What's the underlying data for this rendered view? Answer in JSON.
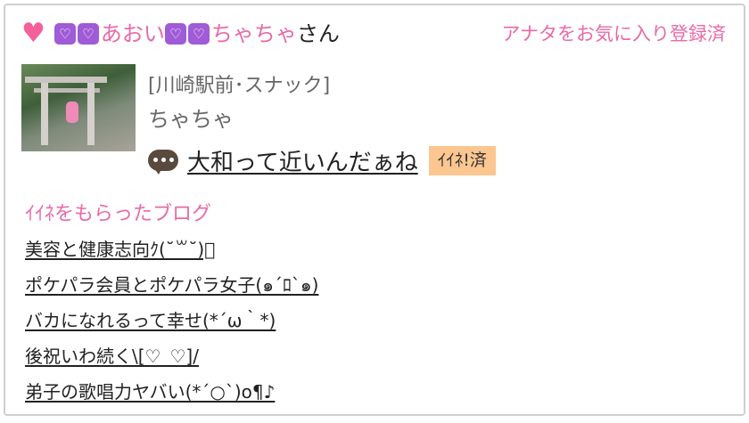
{
  "header": {
    "heart_icon": "heart-icon",
    "emoji_icon": "white-heart-purple-square-icon",
    "emoji_glyph": "♡",
    "name_part1": "あおい",
    "name_part2": "ちゃちゃ",
    "honorific": "さん",
    "favorite_status": "アナタをお気に入り登録済"
  },
  "profile": {
    "shop_info": "[川崎駅前･スナック]",
    "name": "ちゃちゃ"
  },
  "post": {
    "title": "大和って近いんだぁね",
    "like_badge": "ｲｲﾈ!済"
  },
  "liked_blogs": {
    "title": "ｲｲﾈをもらったブログ",
    "items": [
      "美容と健康志向ｸ(˘꒳˘)ﾞ",
      "ポケパラ会員とポケパラ女子(๑´ﾛ`๑)",
      "バカになれるって幸せ(*´ω｀*)",
      "後祝いわ続く\\[♡_♡]/",
      "弟子の歌唱力ヤバい(*´○`)o¶♪"
    ]
  },
  "colors": {
    "pink": "#e86aa8",
    "heart": "#f4609a",
    "purple": "#a05bd6",
    "badge": "#fcc691"
  }
}
